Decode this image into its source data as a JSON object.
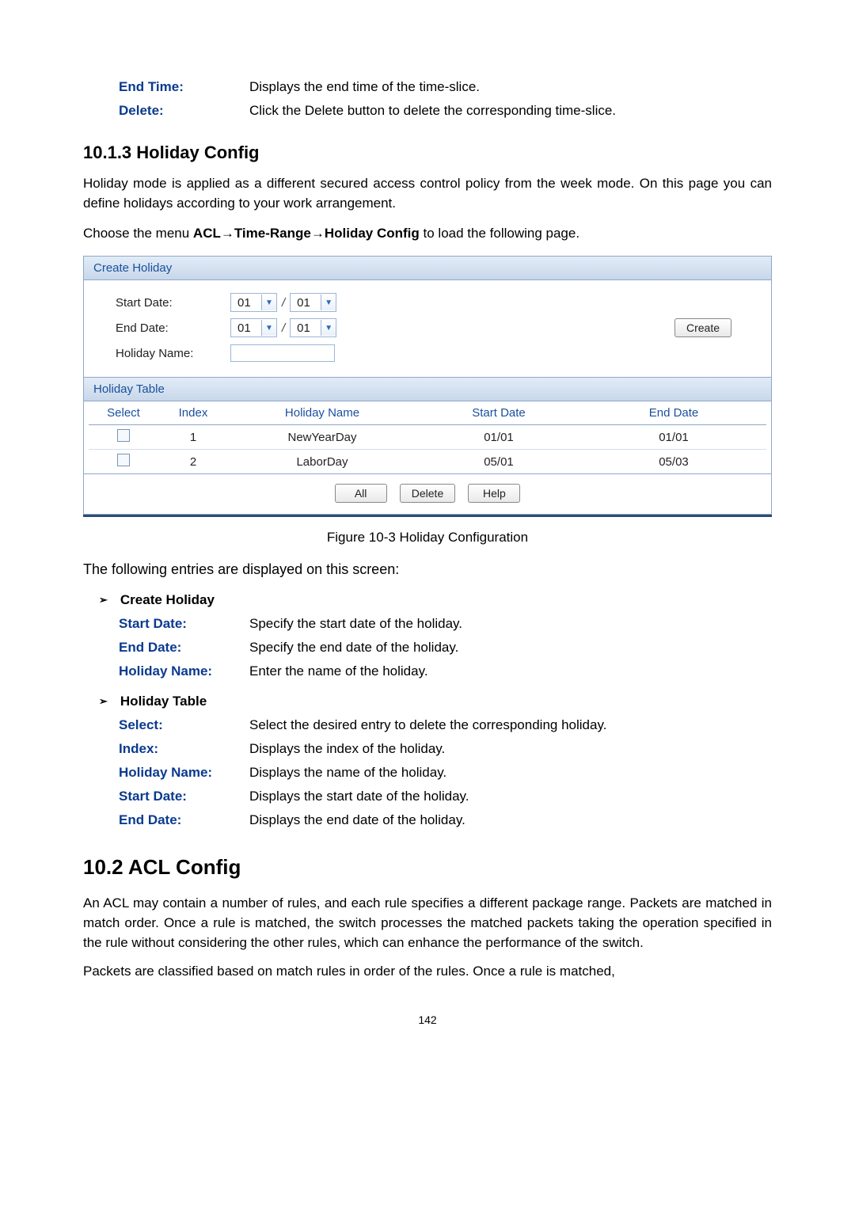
{
  "top_defs": [
    {
      "label": "End Time:",
      "text": "Displays the end time of the time-slice."
    },
    {
      "label": "Delete:",
      "text": "Click the Delete button to delete the corresponding time-slice."
    }
  ],
  "section1": {
    "heading": "10.1.3  Holiday Config",
    "para": "Holiday mode is applied as a different secured access control policy from the week mode. On this page you can define holidays according to your work arrangement.",
    "menu_prefix": "Choose the menu ",
    "menu_bold": "ACL→Time-Range→Holiday Config",
    "menu_suffix": " to load the following page."
  },
  "figure": {
    "create_title": "Create Holiday",
    "labels": {
      "start": "Start Date:",
      "end": "End Date:",
      "name": "Holiday Name:"
    },
    "sel": {
      "m1": "01",
      "d1": "01",
      "m2": "01",
      "d2": "01"
    },
    "create_btn": "Create",
    "table_title": "Holiday Table",
    "cols": {
      "select": "Select",
      "index": "Index",
      "hname": "Holiday Name",
      "sdate": "Start Date",
      "edate": "End Date"
    },
    "rows": [
      {
        "index": "1",
        "hname": "NewYearDay",
        "sdate": "01/01",
        "edate": "01/01"
      },
      {
        "index": "2",
        "hname": "LaborDay",
        "sdate": "05/01",
        "edate": "05/03"
      }
    ],
    "buttons": {
      "all": "All",
      "delete": "Delete",
      "help": "Help"
    },
    "caption": "Figure 10-3 Holiday Configuration"
  },
  "entries_intro": "The following entries are displayed on this screen:",
  "group1": {
    "title": "Create Holiday",
    "items": [
      {
        "label": "Start Date:",
        "text": "Specify the start date of the holiday."
      },
      {
        "label": "End Date:",
        "text": "Specify the end date of the holiday."
      },
      {
        "label": "Holiday Name:",
        "text": "Enter the name of the holiday."
      }
    ]
  },
  "group2": {
    "title": "Holiday Table",
    "items": [
      {
        "label": "Select:",
        "text": "Select the desired entry to delete the corresponding holiday."
      },
      {
        "label": "Index:",
        "text": "Displays the index of the holiday."
      },
      {
        "label": "Holiday Name:",
        "text": "Displays the name of the holiday."
      },
      {
        "label": "Start Date:",
        "text": "Displays the start date of the holiday."
      },
      {
        "label": "End Date:",
        "text": "Displays the end date of the holiday."
      }
    ]
  },
  "section2": {
    "heading": "10.2 ACL Config",
    "para1": "An ACL may contain a number of rules, and each rule specifies a different package range. Packets are matched in match order. Once a rule is matched, the switch processes the matched packets taking the operation specified in the rule without considering the other rules, which can enhance the performance of the switch.",
    "para2": "Packets are classified based on match rules in order of the rules. Once a rule is matched,"
  },
  "page_number": "142"
}
